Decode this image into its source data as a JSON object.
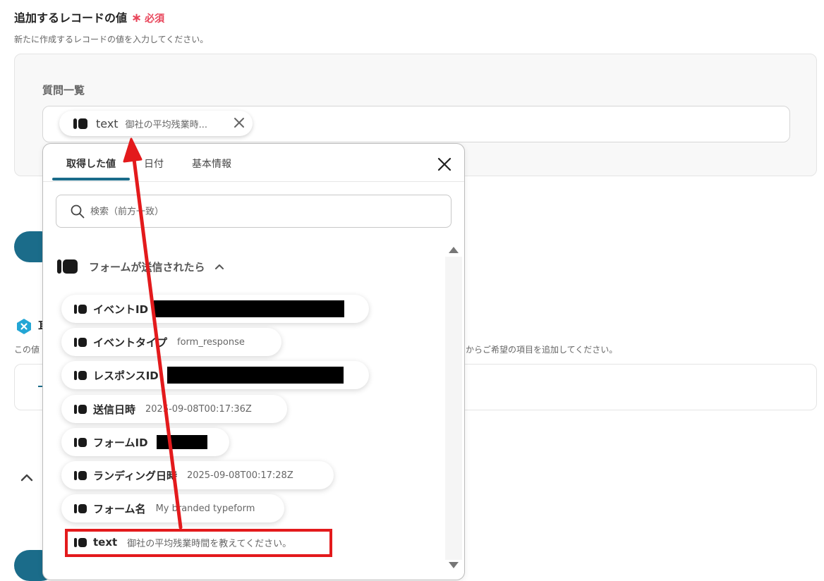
{
  "section": {
    "title": "追加するレコードの値",
    "required_label": "必須",
    "required_star": "∗",
    "description": "新たに作成するレコードの値を入力してください。"
  },
  "field": {
    "label": "質問一覧",
    "chip": {
      "key": "text",
      "value": "御社の平均残業時..."
    }
  },
  "background": {
    "title_fragment": "耳",
    "desc_left": "この値",
    "desc_right": "からご希望の項目を追加してください。"
  },
  "panel": {
    "tabs": [
      {
        "label": "取得した値",
        "active": true
      },
      {
        "label": "日付",
        "active": false
      },
      {
        "label": "基本情報",
        "active": false
      }
    ],
    "search": {
      "placeholder": "検索（前方一致）",
      "value": ""
    },
    "group": {
      "title": "フォームが送信されたら",
      "expanded": true
    },
    "items": [
      {
        "label": "イベントID",
        "value": "",
        "redacted": true
      },
      {
        "label": "イベントタイプ",
        "value": "form_response",
        "redacted": false
      },
      {
        "label": "レスポンスID",
        "value": "",
        "redacted": true
      },
      {
        "label": "送信日時",
        "value": "2025-09-08T00:17:36Z",
        "redacted": false
      },
      {
        "label": "フォームID",
        "value": "",
        "redacted": true
      },
      {
        "label": "ランディング日時",
        "value": "2025-09-08T00:17:28Z",
        "redacted": false
      },
      {
        "label": "フォーム名",
        "value": "My branded typeform",
        "redacted": false
      },
      {
        "label": "text",
        "value": "御社の平均残業時間を教えてください。",
        "redacted": false,
        "highlighted": true
      }
    ]
  },
  "colors": {
    "accent": "#1b6c8a",
    "required": "#e8455a",
    "annotation": "#e31a1c"
  },
  "icons": [
    "typeform-icon",
    "close-icon",
    "search-icon",
    "chevron-up-icon",
    "x-badge-icon"
  ]
}
